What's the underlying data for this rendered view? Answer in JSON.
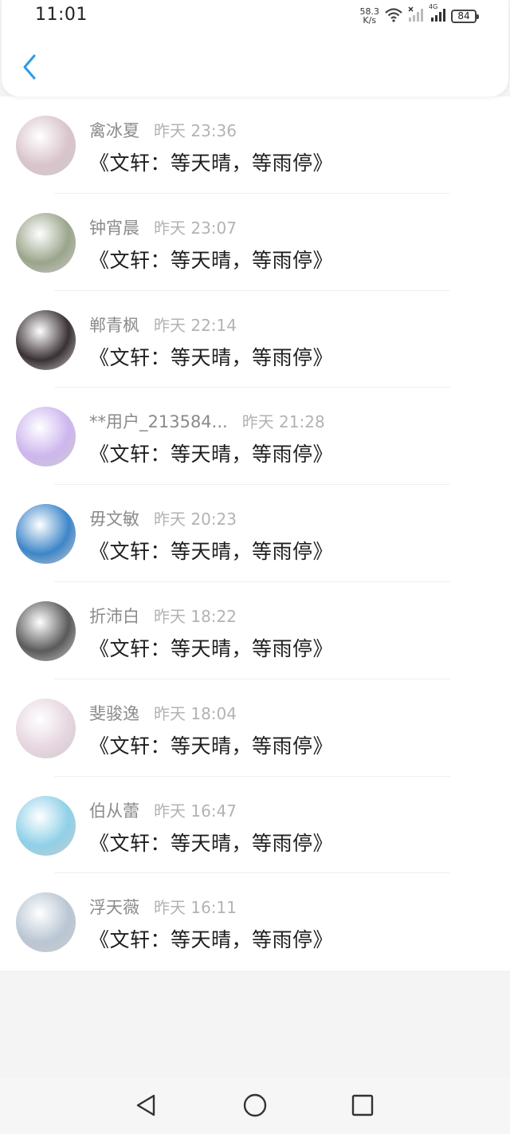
{
  "status_bar": {
    "time": "11:01",
    "net_speed_value": "58.3",
    "net_speed_unit": "K/s",
    "network": "4G",
    "battery": "84"
  },
  "header": {
    "back_icon": "chevron-left-icon",
    "accent_color": "#2d9be6"
  },
  "comments": [
    {
      "name": "禽冰夏",
      "time": "昨天 23:36",
      "text": "《文轩：等天晴，等雨停》",
      "avatar_color": "#d9c4cc"
    },
    {
      "name": "钟宵晨",
      "time": "昨天 23:07",
      "text": "《文轩：等天晴，等雨停》",
      "avatar_color": "#9aa58b"
    },
    {
      "name": "郸青枫",
      "time": "昨天 22:14",
      "text": "《文轩：等天晴，等雨停》",
      "avatar_color": "#3a3133"
    },
    {
      "name": "**用户_213584...",
      "time": "昨天 21:28",
      "text": "《文轩：等天晴，等雨停》",
      "avatar_color": "#cdb6ee"
    },
    {
      "name": "毋文敏",
      "time": "昨天 20:23",
      "text": "《文轩：等天晴，等雨停》",
      "avatar_color": "#3d86c9"
    },
    {
      "name": "折沛白",
      "time": "昨天 18:22",
      "text": "《文轩：等天晴，等雨停》",
      "avatar_color": "#5a5a5a"
    },
    {
      "name": "斐骏逸",
      "time": "昨天 18:04",
      "text": "《文轩：等天晴，等雨停》",
      "avatar_color": "#e7d6e0"
    },
    {
      "name": "伯从蕾",
      "time": "昨天 16:47",
      "text": "《文轩：等天晴，等雨停》",
      "avatar_color": "#8fd0e8"
    },
    {
      "name": "浮天薇",
      "time": "昨天 16:11",
      "text": "《文轩：等天晴，等雨停》",
      "avatar_color": "#b9c6d4"
    }
  ],
  "nav": {
    "back_icon": "triangle-back-icon",
    "home_icon": "circle-home-icon",
    "recents_icon": "square-recents-icon"
  }
}
